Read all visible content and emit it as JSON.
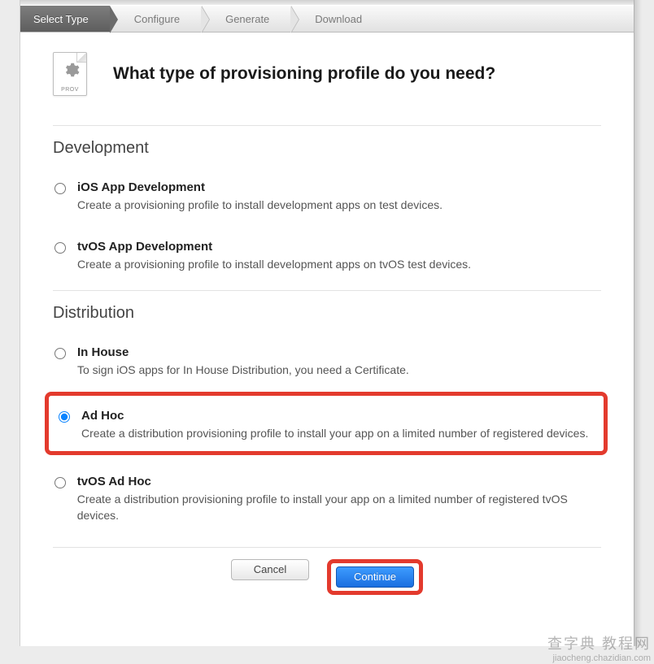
{
  "breadcrumb": {
    "steps": [
      "Select Type",
      "Configure",
      "Generate",
      "Download"
    ],
    "active_index": 0
  },
  "header": {
    "icon_label": "PROV",
    "title": "What type of provisioning profile do you need?"
  },
  "sections": [
    {
      "title": "Development",
      "options": [
        {
          "id": "ios-app-dev",
          "label": "iOS App Development",
          "desc": "Create a provisioning profile to install development apps on test devices.",
          "selected": false,
          "highlighted": false
        },
        {
          "id": "tvos-app-dev",
          "label": "tvOS App Development",
          "desc": "Create a provisioning profile to install development apps on tvOS test devices.",
          "selected": false,
          "highlighted": false
        }
      ]
    },
    {
      "title": "Distribution",
      "options": [
        {
          "id": "in-house",
          "label": "In House",
          "desc": "To sign iOS apps for In House Distribution, you need a Certificate.",
          "selected": false,
          "highlighted": false
        },
        {
          "id": "ad-hoc",
          "label": "Ad Hoc",
          "desc": "Create a distribution provisioning profile to install your app on a limited number of registered devices.",
          "selected": true,
          "highlighted": true
        },
        {
          "id": "tvos-ad-hoc",
          "label": "tvOS Ad Hoc",
          "desc": "Create a distribution provisioning profile to install your app on a limited number of registered tvOS devices.",
          "selected": false,
          "highlighted": false
        }
      ]
    }
  ],
  "footer": {
    "cancel_label": "Cancel",
    "continue_label": "Continue"
  },
  "watermark": {
    "line1": "查字典 教程网",
    "line2": "jiaocheng.chazidian.com"
  }
}
